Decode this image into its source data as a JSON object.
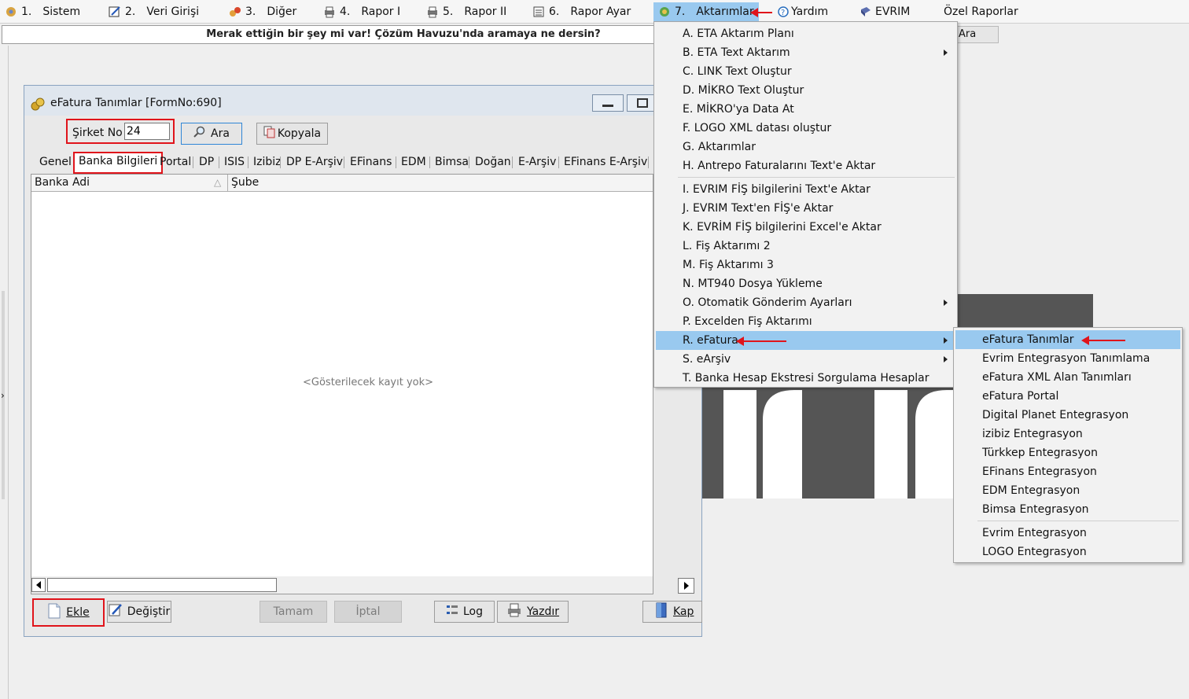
{
  "menubar": {
    "items": [
      {
        "num": "1.",
        "label": "Sistem"
      },
      {
        "num": "2.",
        "label": "Veri Girişi"
      },
      {
        "num": "3.",
        "label": "Diğer"
      },
      {
        "num": "4.",
        "label": "Rapor I"
      },
      {
        "num": "5.",
        "label": "Rapor II"
      },
      {
        "num": "6.",
        "label": "Rapor Ayar"
      },
      {
        "num": "7.",
        "label": "Aktarımlar"
      },
      {
        "num": "",
        "label": "Yardım"
      },
      {
        "num": "",
        "label": "EVRIM"
      },
      {
        "num": "",
        "label": "Özel Raporlar"
      }
    ]
  },
  "strip": {
    "banner": "Merak ettiğin bir şey mi var! Çözüm Havuzu'nda aramaya ne dersin?",
    "side_text": "Ara"
  },
  "window": {
    "title": "eFatura Tanımlar [FormNo:690]",
    "sirket_label": "Şirket No",
    "sirket_value": "24",
    "ara_label": "Ara",
    "kopyala_label": "Kopyala",
    "tabs": [
      "Genel",
      "Banka Bilgileri",
      "Portal",
      "DP",
      "ISIS",
      "Izibiz",
      "DP E-Arşiv",
      "EFinans",
      "EDM",
      "Bimsa",
      "Doğan",
      "E-Arşiv",
      "EFinans E-Arşiv"
    ],
    "columns": [
      "Banka Adi",
      "Şube"
    ],
    "empty_text": "<Gösterilecek kayıt yok>",
    "buttons": {
      "ekle": "Ekle",
      "degistir": "Değiştir",
      "tamam": "Tamam",
      "iptal": "İptal",
      "log": "Log",
      "yazdir": "Yazdır",
      "kapat": "Kap"
    }
  },
  "aktarimlar_menu": {
    "items": [
      {
        "label": "A.  ETA Aktarım Planı",
        "submenu": false
      },
      {
        "label": "B.  ETA Text Aktarım",
        "submenu": true
      },
      {
        "label": "C.  LINK Text Oluştur",
        "submenu": false
      },
      {
        "label": "D.  MİKRO Text Oluştur",
        "submenu": false
      },
      {
        "label": "E.  MİKRO'ya  Data  At",
        "submenu": false
      },
      {
        "label": "F.  LOGO XML datası oluştur",
        "submenu": false
      },
      {
        "label": "G.  Aktarımlar",
        "submenu": false
      },
      {
        "label": "H.  Antrepo Faturalarını Text'e Aktar",
        "submenu": false
      },
      {
        "label": "I.   EVRIM FİŞ bilgilerini Text'e Aktar",
        "submenu": false
      },
      {
        "label": "J.   EVRIM Text'en FİŞ'e Aktar",
        "submenu": false
      },
      {
        "label": "K.   EVRİM FİŞ bilgilerini Excel'e Aktar",
        "submenu": false
      },
      {
        "label": "L.   Fiş Aktarımı 2",
        "submenu": false
      },
      {
        "label": "M.  Fiş Aktarımı 3",
        "submenu": false
      },
      {
        "label": "N.  MT940 Dosya Yükleme",
        "submenu": false
      },
      {
        "label": "O. Otomatik Gönderim Ayarları",
        "submenu": true
      },
      {
        "label": "P.  Excelden Fiş Aktarımı",
        "submenu": false
      },
      {
        "label": "R. eFatura",
        "submenu": true
      },
      {
        "label": "S.  eArşiv",
        "submenu": true
      },
      {
        "label": "T. Banka Hesap Ekstresi Sorgulama Hesaplar",
        "submenu": false
      }
    ]
  },
  "efatura_submenu": {
    "items": [
      "eFatura Tanımlar",
      "Evrim Entegrasyon Tanımlama",
      "eFatura XML Alan Tanımları",
      "eFatura Portal",
      "Digital Planet Entegrasyon",
      "izibiz Entegrasyon",
      "Türkkep Entegrasyon",
      "EFinans Entegrasyon",
      "EDM Entegrasyon",
      "Bimsa Entegrasyon",
      "Evrim Entegrasyon",
      "LOGO Entegrasyon"
    ]
  },
  "colors": {
    "highlight": "#99c9ef",
    "annotation_red": "#e0141b"
  }
}
